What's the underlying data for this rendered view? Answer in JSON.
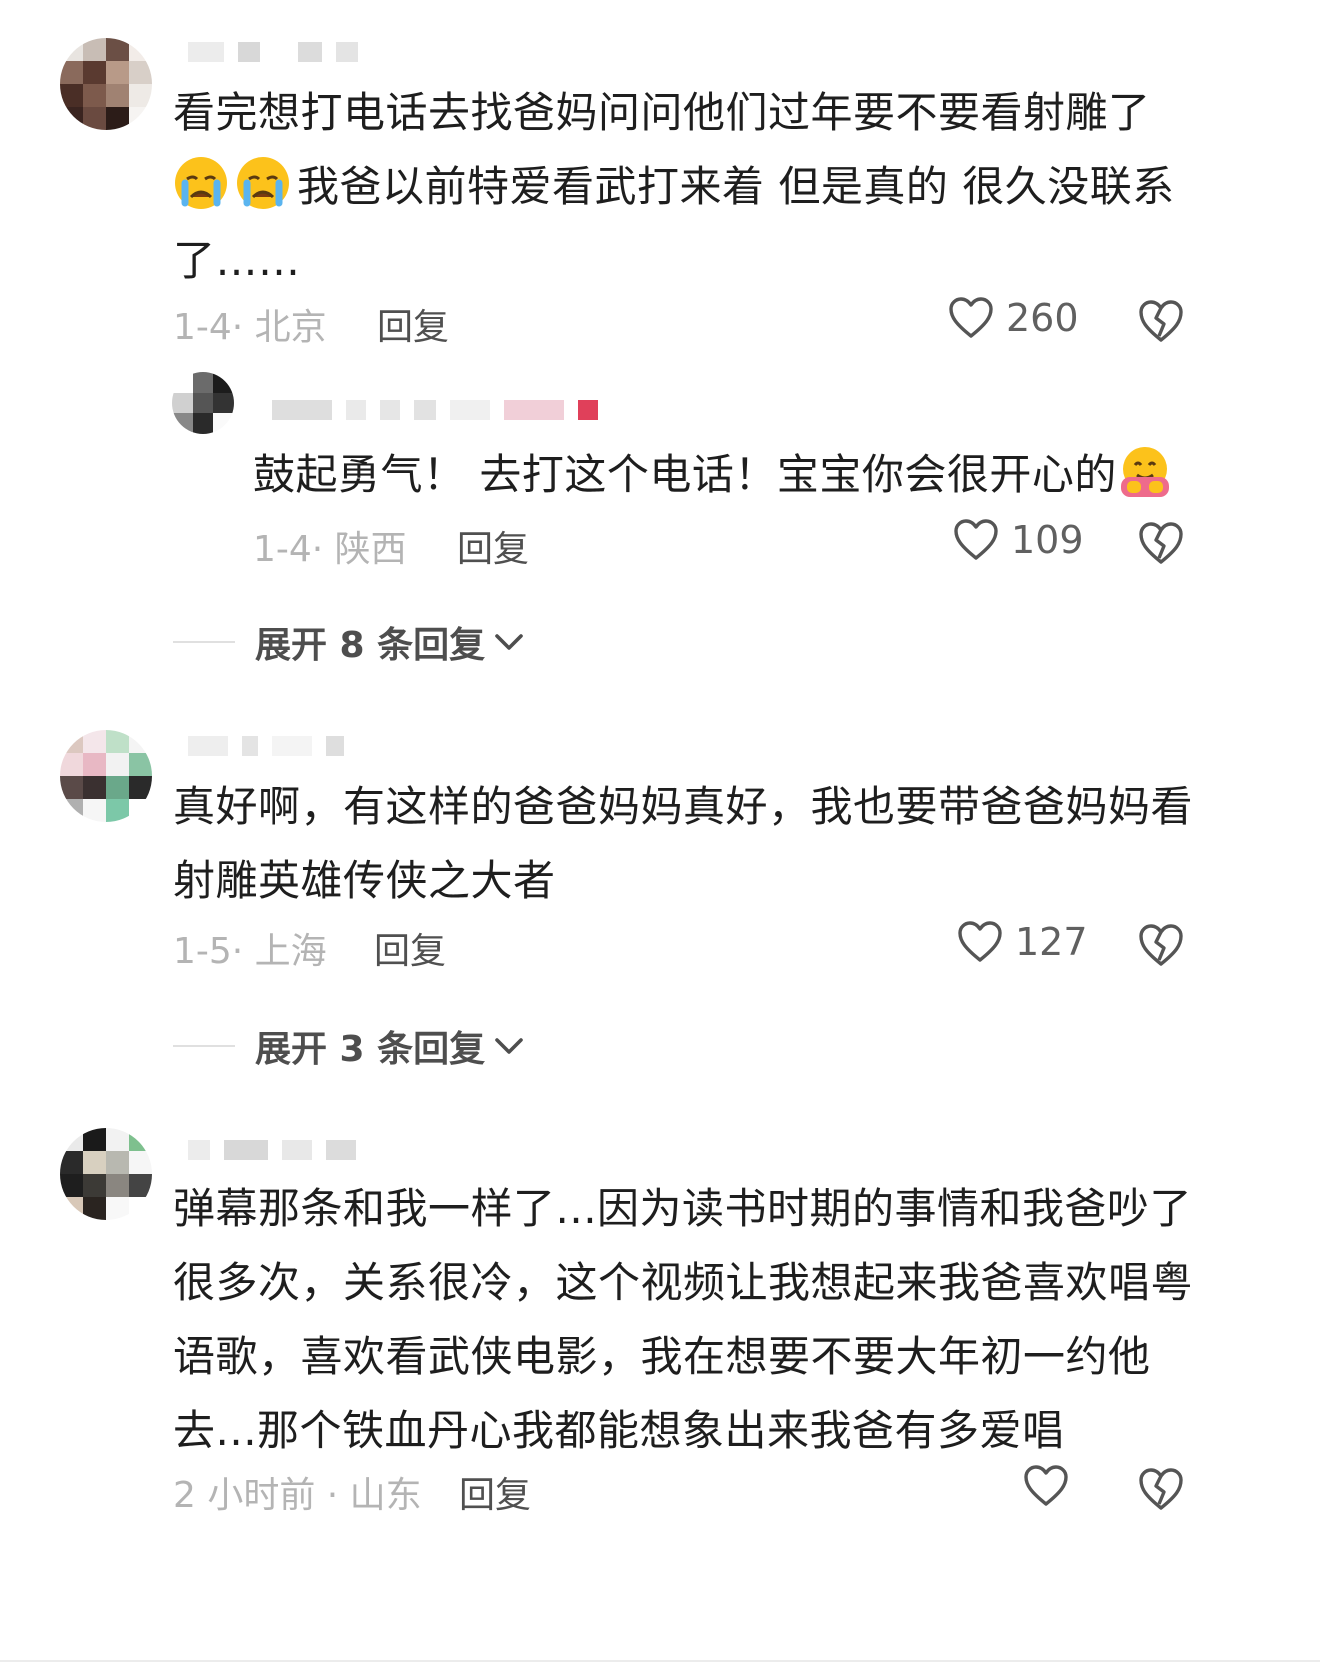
{
  "comments": [
    {
      "text_line1": "看完想打电话去找爸妈问问他们过年要不要看射雕了",
      "text_line2": "我爸以前特爱看武打来着 但是真的 很久没联系",
      "text_line3": "了……",
      "emoji": "crying-face",
      "date_location": "1-4· 北京",
      "reply_label": "回复",
      "like_count": "260",
      "reply": {
        "text": "鼓起勇气！ 去打这个电话！宝宝你会很开心的",
        "emoji": "hugging-face",
        "date_location": "1-4· 陕西",
        "reply_label": "回复",
        "like_count": "109"
      },
      "expand_label": "展开 8 条回复"
    },
    {
      "text_line1": "真好啊，有这样的爸爸妈妈真好，我也要带爸爸妈妈看",
      "text_line2": "射雕英雄传侠之大者",
      "date_location": "1-5· 上海",
      "reply_label": "回复",
      "like_count": "127",
      "expand_label": "展开 3 条回复"
    },
    {
      "text_line1": "弹幕那条和我一样了...因为读书时期的事情和我爸吵了",
      "text_line2": "很多次，关系很冷，这个视频让我想起来我爸喜欢唱粤",
      "text_line3": "语歌，喜欢看武侠电影，我在想要不要大年初一约他",
      "text_line4": "去...那个铁血丹心我都能想象出来我爸有多爱唱",
      "date_location": "2 小时前 · 山东",
      "reply_label": "回复",
      "like_count": ""
    }
  ],
  "icons": {
    "like": "heart-outline-icon",
    "dislike": "broken-heart-icon",
    "expand": "chevron-down-icon"
  },
  "colors": {
    "text": "#1e1e1e",
    "meta": "#b4b4b4",
    "action": "#505050"
  }
}
